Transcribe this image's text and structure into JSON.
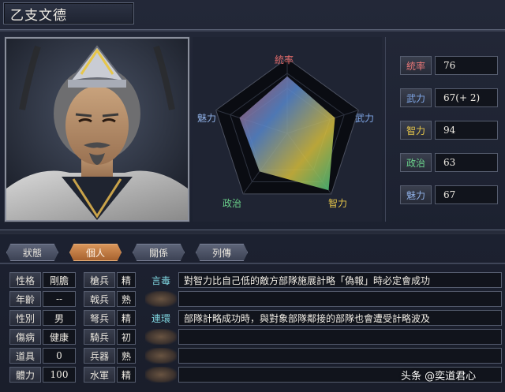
{
  "title": "乙支文德",
  "radar": {
    "labels": {
      "command": "統率",
      "strength": "武力",
      "intelligence": "智力",
      "politics": "政治",
      "charisma": "魅力"
    },
    "values": {
      "command": 76,
      "strength": 67,
      "intelligence": 94,
      "politics": 63,
      "charisma": 67
    },
    "max": 100,
    "colors": {
      "command": "#e06a6a",
      "strength": "#7fa6e6",
      "intelligence": "#e6c64a",
      "politics": "#6ad08a",
      "charisma": "#8fb0e6"
    }
  },
  "stats": [
    {
      "name": "統率",
      "value": "76",
      "color": "#e87878"
    },
    {
      "name": "武力",
      "value": "67(+ 2)",
      "color": "#7fa6e6"
    },
    {
      "name": "智力",
      "value": "94",
      "color": "#e6c64a"
    },
    {
      "name": "政治",
      "value": "63",
      "color": "#6ad08a"
    },
    {
      "name": "魅力",
      "value": "67",
      "color": "#8fb0e6"
    }
  ],
  "tabs": [
    {
      "label": "狀態",
      "active": false
    },
    {
      "label": "個人",
      "active": true
    },
    {
      "label": "關係",
      "active": false
    },
    {
      "label": "列傳",
      "active": false
    }
  ],
  "attributes": [
    {
      "name": "性格",
      "value": "剛膽"
    },
    {
      "name": "年齡",
      "value": "--"
    },
    {
      "name": "性別",
      "value": "男"
    },
    {
      "name": "傷病",
      "value": "健康"
    },
    {
      "name": "道具",
      "value": "0"
    },
    {
      "name": "體力",
      "value": "100"
    }
  ],
  "troops": [
    {
      "name": "槍兵",
      "value": "精"
    },
    {
      "name": "戟兵",
      "value": "熟"
    },
    {
      "name": "弩兵",
      "value": "精"
    },
    {
      "name": "騎兵",
      "value": "初"
    },
    {
      "name": "兵器",
      "value": "熟"
    },
    {
      "name": "水軍",
      "value": "精"
    }
  ],
  "skills": [
    {
      "tag": "言毒",
      "desc": "對智力比自己低的敵方部隊施展計略「偽報」時必定會成功"
    },
    {
      "tag": "",
      "desc": ""
    },
    {
      "tag": "連環",
      "desc": "部隊計略成功時，與對象部隊鄰接的部隊也會遭受計略波及"
    },
    {
      "tag": "",
      "desc": ""
    },
    {
      "tag": "",
      "desc": ""
    },
    {
      "tag": "",
      "desc": ""
    }
  ],
  "watermark": "头条 @奕道君心"
}
